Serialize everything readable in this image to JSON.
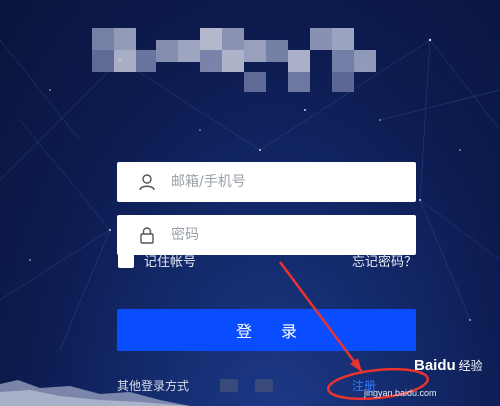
{
  "login_form": {
    "email_placeholder": "邮箱/手机号",
    "password_placeholder": "密码",
    "remember_label": "记住帐号",
    "forgot_label": "忘记密码？",
    "login_button": "登 录",
    "other_login_label": "其他登录方式",
    "register_label": "注册"
  },
  "watermark": {
    "brand": "Baidu",
    "suffix": "经验",
    "url": "jingyan.baidu.com"
  },
  "colors": {
    "background": "#0d1b4f",
    "primary_button": "#0a4cff",
    "register_link": "#2f7bff",
    "annotation": "#e8332e"
  },
  "icons": {
    "email": "user-icon",
    "password": "lock-icon"
  }
}
